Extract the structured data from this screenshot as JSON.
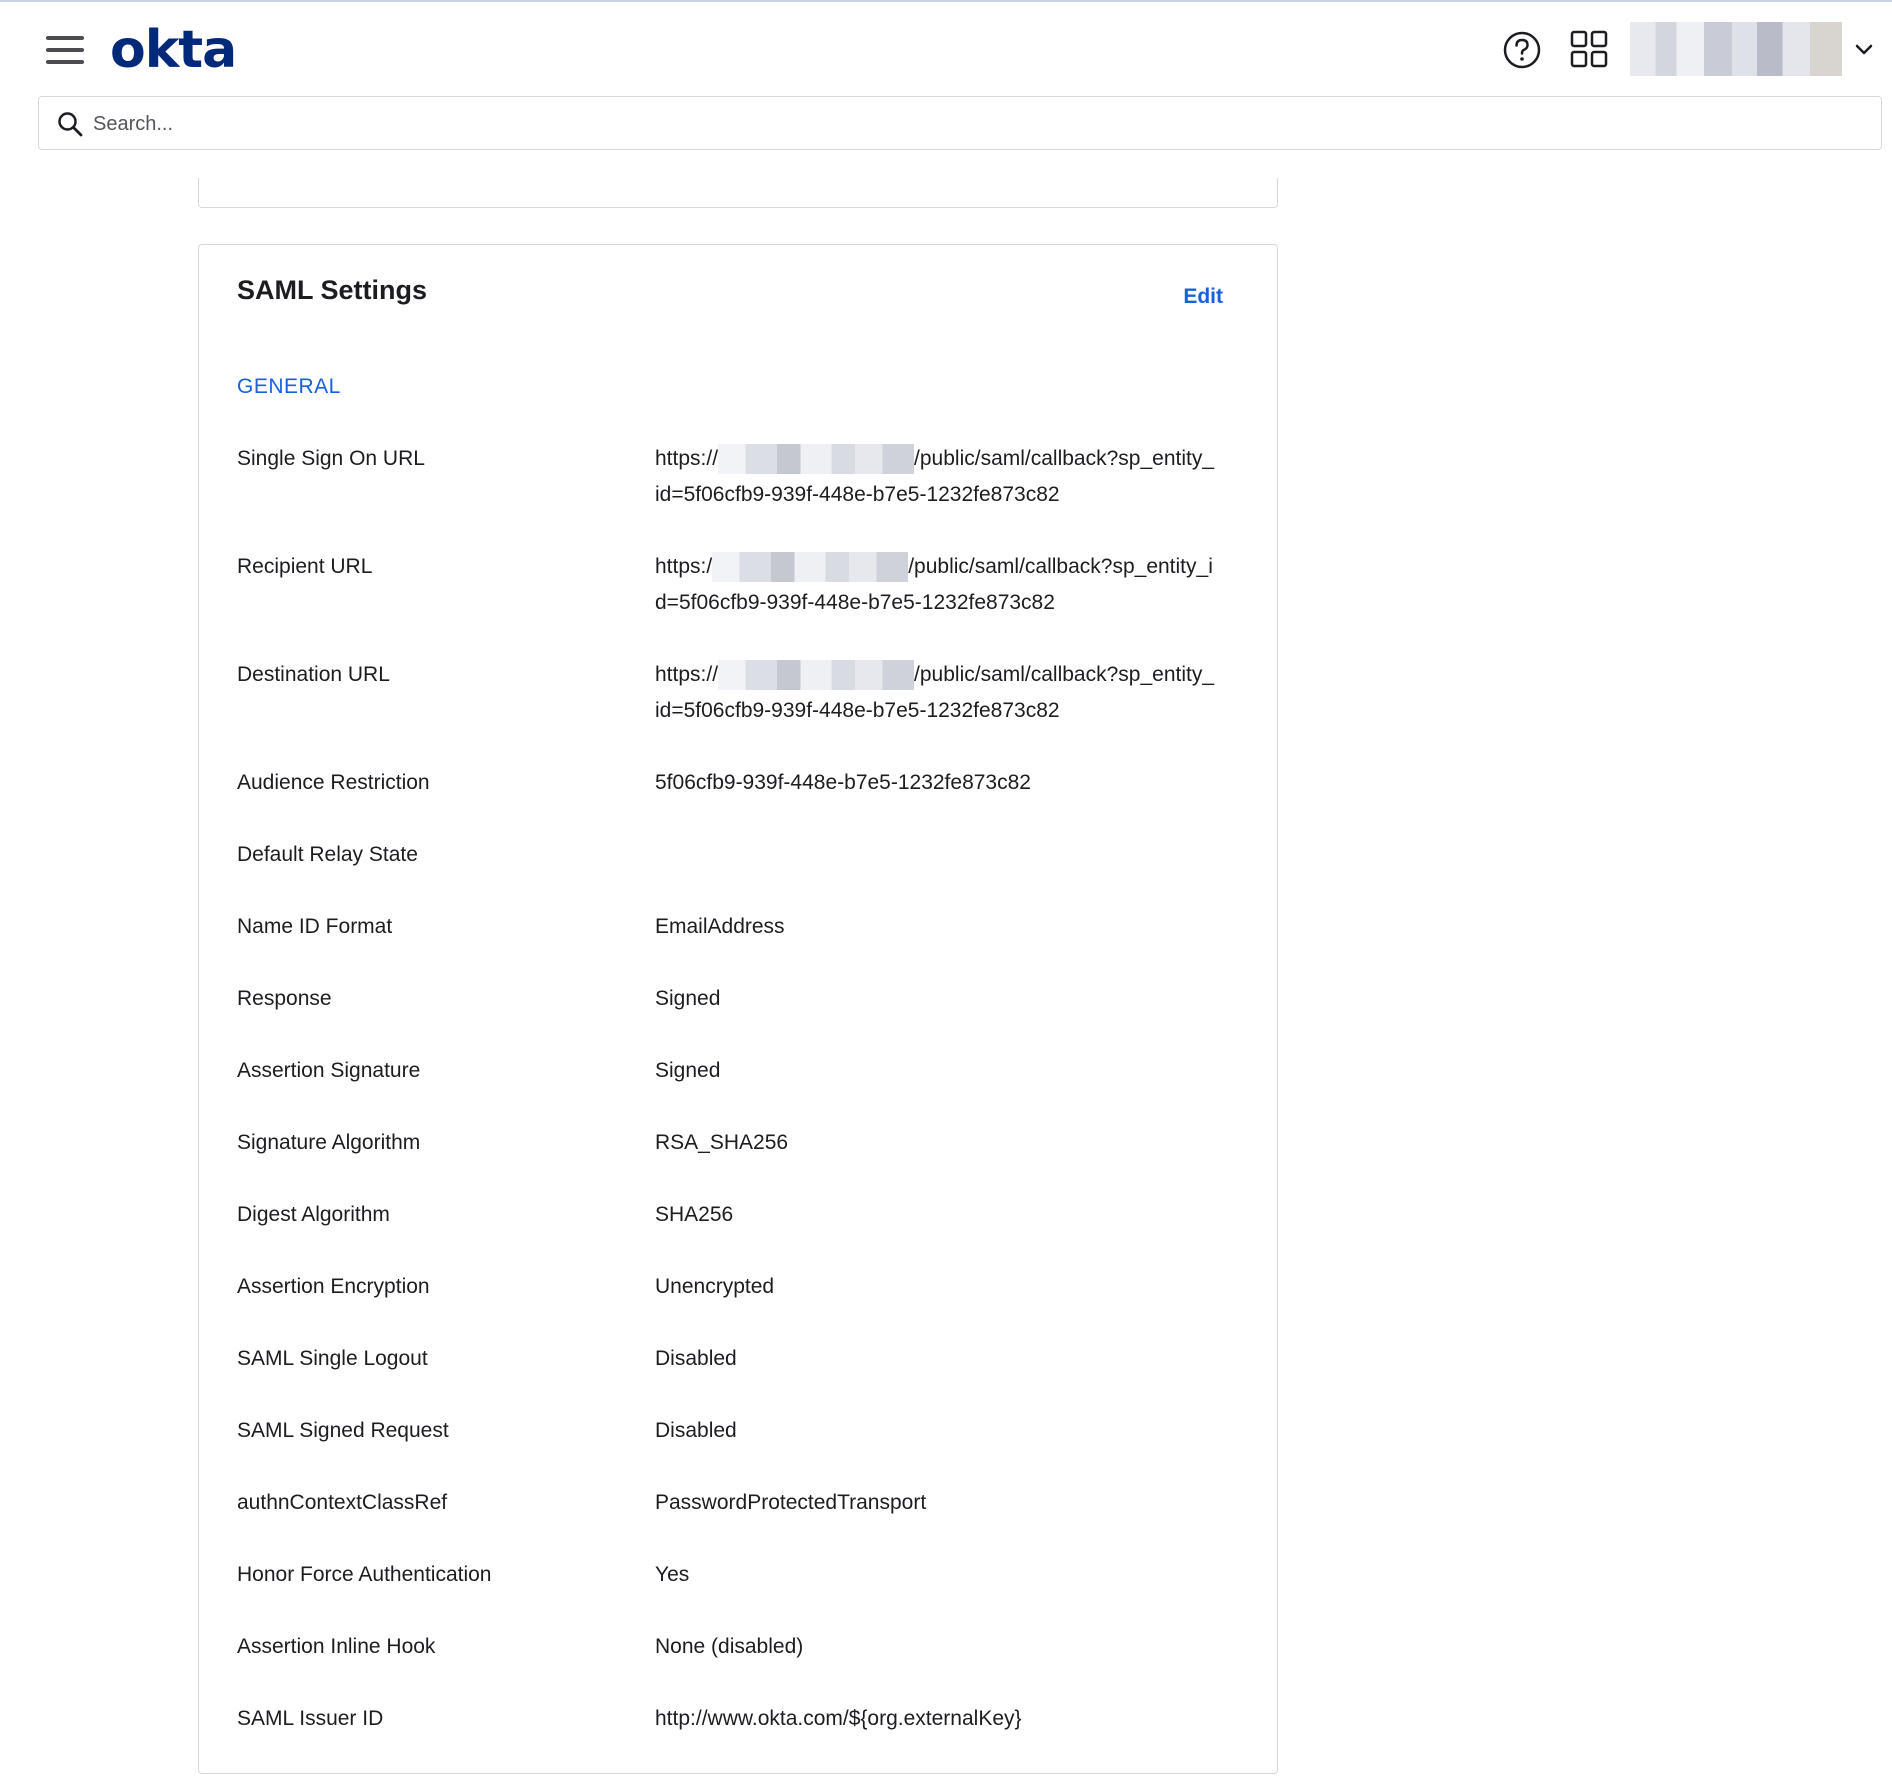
{
  "header": {
    "logo_text": "okta",
    "menu_icon": "hamburger-menu-icon",
    "help_icon": "help-circle-icon",
    "apps_icon": "app-grid-icon",
    "user_menu_icon": "chevron-down-icon"
  },
  "search": {
    "placeholder": "Search...",
    "value": ""
  },
  "saml_settings": {
    "title": "SAML Settings",
    "edit_label": "Edit",
    "section_general": "GENERAL",
    "rows": [
      {
        "label": "Single Sign On URL",
        "value_prefix": "https://",
        "value_suffix": "/public/saml/callback?sp_entity_id=5f06cfb9-939f-448e-b7e5-1232fe873c82"
      },
      {
        "label": "Recipient URL",
        "value_prefix": "https:/",
        "value_suffix": "/public/saml/callback?sp_entity_id=5f06cfb9-939f-448e-b7e5-1232fe873c82"
      },
      {
        "label": "Destination URL",
        "value_prefix": "https://",
        "value_suffix": "/public/saml/callback?sp_entity_id=5f06cfb9-939f-448e-b7e5-1232fe873c82"
      },
      {
        "label": "Audience Restriction",
        "value": "5f06cfb9-939f-448e-b7e5-1232fe873c82"
      },
      {
        "label": "Default Relay State",
        "value": ""
      },
      {
        "label": "Name ID Format",
        "value": "EmailAddress"
      },
      {
        "label": "Response",
        "value": "Signed"
      },
      {
        "label": "Assertion Signature",
        "value": "Signed"
      },
      {
        "label": "Signature Algorithm",
        "value": "RSA_SHA256"
      },
      {
        "label": "Digest Algorithm",
        "value": "SHA256"
      },
      {
        "label": "Assertion Encryption",
        "value": "Unencrypted"
      },
      {
        "label": "SAML Single Logout",
        "value": "Disabled"
      },
      {
        "label": "SAML Signed Request",
        "value": "Disabled"
      },
      {
        "label": "authnContextClassRef",
        "value": "PasswordProtectedTransport"
      },
      {
        "label": "Honor Force Authentication",
        "value": "Yes"
      },
      {
        "label": "Assertion Inline Hook",
        "value": "None (disabled)"
      },
      {
        "label": "SAML Issuer ID",
        "value": "http://www.okta.com/${org.externalKey}"
      }
    ]
  },
  "colors": {
    "brand": "#00297a",
    "link": "#1662dd",
    "text": "#1d1d21",
    "border": "#d7d7dc"
  }
}
